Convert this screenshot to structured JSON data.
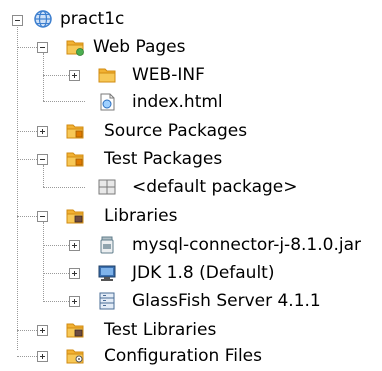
{
  "tree": {
    "root": {
      "label": "pract1c",
      "icon": "web-globe-icon",
      "expanded": true
    },
    "items": [
      {
        "label": "Web Pages",
        "icon": "web-pages-folder-icon",
        "expanded": true
      },
      {
        "label": "WEB-INF",
        "icon": "folder-icon",
        "expanded": false
      },
      {
        "label": "index.html",
        "icon": "html-file-icon"
      },
      {
        "label": "Source Packages",
        "icon": "source-packages-icon",
        "expanded": false
      },
      {
        "label": "Test Packages",
        "icon": "test-packages-icon",
        "expanded": true
      },
      {
        "label": "<default package>",
        "icon": "package-icon"
      },
      {
        "label": "Libraries",
        "icon": "libraries-icon",
        "expanded": true
      },
      {
        "label": "mysql-connector-j-8.1.0.jar",
        "icon": "jar-icon",
        "expanded": false
      },
      {
        "label": "JDK 1.8 (Default)",
        "icon": "jdk-monitor-icon",
        "expanded": false
      },
      {
        "label": "GlassFish Server 4.1.1",
        "icon": "server-icon",
        "expanded": false
      },
      {
        "label": "Test Libraries",
        "icon": "test-libraries-icon",
        "expanded": false
      },
      {
        "label": "Configuration Files",
        "icon": "configuration-files-icon",
        "expanded": false
      }
    ]
  },
  "colors": {
    "folder": "#f2b233",
    "folder_dark": "#d18b12",
    "globe": "#3d7fcf",
    "tree_lines": "#9a9a9a"
  }
}
